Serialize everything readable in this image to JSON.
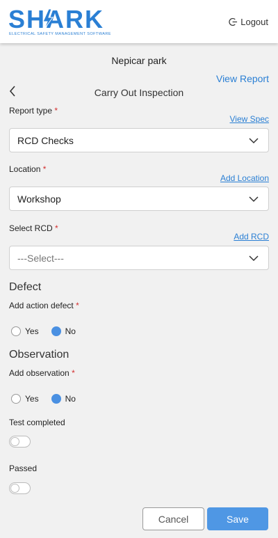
{
  "brand": {
    "name": "SHARK",
    "tagline": "ELECTRICAL SAFETY MANAGEMENT SOFTWARE",
    "color": "#2a7fd4"
  },
  "header": {
    "logout_label": "Logout"
  },
  "site_name": "Nepicar park",
  "view_report_label": "View Report",
  "page_title": "Carry Out Inspection",
  "report_type": {
    "label": "Report type",
    "required_mark": "*",
    "link_label": "View Spec",
    "value": "RCD Checks"
  },
  "location": {
    "label": "Location",
    "required_mark": "*",
    "link_label": "Add Location",
    "value": "Workshop"
  },
  "select_rcd": {
    "label": "Select RCD",
    "required_mark": "*",
    "link_label": "Add RCD",
    "value": "---Select---"
  },
  "defect": {
    "heading": "Defect",
    "question": "Add action defect",
    "required_mark": "*",
    "options": [
      "Yes",
      "No"
    ],
    "selected": "No"
  },
  "observation": {
    "heading": "Observation",
    "question": "Add observation",
    "required_mark": "*",
    "options": [
      "Yes",
      "No"
    ],
    "selected": "No"
  },
  "test_completed": {
    "label": "Test completed",
    "on": false
  },
  "passed": {
    "label": "Passed",
    "on": false
  },
  "buttons": {
    "cancel": "Cancel",
    "save": "Save"
  },
  "colors": {
    "accent": "#4a90e2",
    "link": "#2a7fd4",
    "required": "#d32f2f",
    "background": "#f1f1f1"
  }
}
